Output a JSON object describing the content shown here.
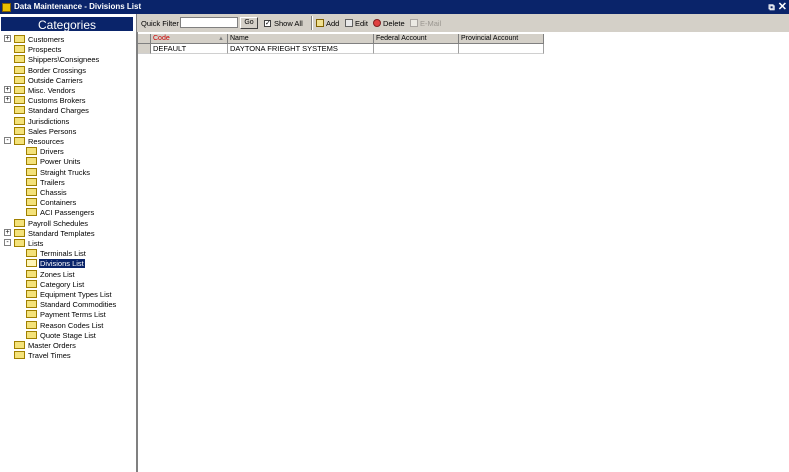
{
  "window": {
    "title": "Data Maintenance - Divisions List",
    "controls": [
      "minimize-restore",
      "close"
    ]
  },
  "sidebar": {
    "header": "Categories",
    "tree": [
      {
        "label": "Customers",
        "expander": "+"
      },
      {
        "label": "Prospects"
      },
      {
        "label": "Shippers\\Consignees"
      },
      {
        "label": "Border Crossings"
      },
      {
        "label": "Outside Carriers"
      },
      {
        "label": "Misc. Vendors",
        "expander": "+"
      },
      {
        "label": "Customs Brokers",
        "expander": "+"
      },
      {
        "label": "Standard Charges"
      },
      {
        "label": "Jurisdictions"
      },
      {
        "label": "Sales Persons"
      },
      {
        "label": "Resources",
        "expander": "-"
      },
      {
        "label": "Drivers",
        "child": true
      },
      {
        "label": "Power Units",
        "child": true
      },
      {
        "label": "Straight Trucks",
        "child": true
      },
      {
        "label": "Trailers",
        "child": true
      },
      {
        "label": "Chassis",
        "child": true
      },
      {
        "label": "Containers",
        "child": true
      },
      {
        "label": "ACI Passengers",
        "child": true
      },
      {
        "label": "Payroll Schedules"
      },
      {
        "label": "Standard Templates",
        "expander": "+"
      },
      {
        "label": "Lists",
        "expander": "-"
      },
      {
        "label": "Terminals List",
        "child": true
      },
      {
        "label": "Divisions List",
        "child": true,
        "selected": true
      },
      {
        "label": "Zones List",
        "child": true
      },
      {
        "label": "Category List",
        "child": true
      },
      {
        "label": "Equipment Types List",
        "child": true
      },
      {
        "label": "Standard Commodities",
        "child": true
      },
      {
        "label": "Payment Terms List",
        "child": true
      },
      {
        "label": "Reason Codes List",
        "child": true
      },
      {
        "label": "Quote Stage List",
        "child": true
      },
      {
        "label": "Master Orders"
      },
      {
        "label": "Travel Times"
      }
    ]
  },
  "toolbar": {
    "quick_filter_label": "Quick Filter",
    "quick_filter_value": "",
    "go_label": "Go",
    "show_all_label": "Show All",
    "show_all_checked": "✓",
    "add_label": "Add",
    "edit_label": "Edit",
    "delete_label": "Delete",
    "email_label": "E-Mail"
  },
  "grid": {
    "columns": [
      "Code",
      "Name",
      "Federal Account",
      "Provincial Account"
    ],
    "sorted_column": "Code",
    "rows": [
      [
        "DEFAULT",
        "DAYTONA FRIEGHT SYSTEMS",
        "",
        ""
      ]
    ]
  },
  "colors": {
    "titlebar": "#0a246a",
    "selection": "#0a246a",
    "sorted_header_text": "#cc0000",
    "chrome": "#d4d0c8"
  }
}
